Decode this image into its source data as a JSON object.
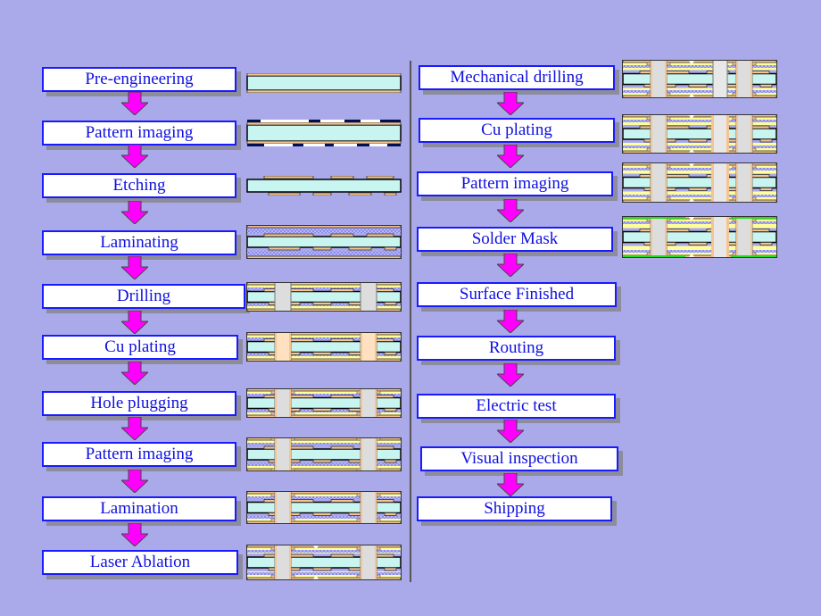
{
  "left_steps": [
    {
      "label": "Pre-engineering"
    },
    {
      "label": "Pattern imaging"
    },
    {
      "label": "Etching"
    },
    {
      "label": "Laminating"
    },
    {
      "label": "Drilling"
    },
    {
      "label": "Cu plating"
    },
    {
      "label": "Hole plugging"
    },
    {
      "label": "Pattern imaging"
    },
    {
      "label": "Lamination"
    },
    {
      "label": "Laser Ablation"
    }
  ],
  "right_steps": [
    {
      "label": "Mechanical drilling"
    },
    {
      "label": "Cu plating"
    },
    {
      "label": "Pattern imaging"
    },
    {
      "label": "Solder Mask"
    },
    {
      "label": "Surface Finished"
    },
    {
      "label": "Routing"
    },
    {
      "label": "Electric test"
    },
    {
      "label": "Visual inspection"
    },
    {
      "label": "Shipping"
    }
  ],
  "colors": {
    "background": "#aaaaea",
    "box_border": "#1a1aff",
    "text": "#1010e0",
    "arrow": "#ff00ff",
    "core": "#c8f5f0",
    "copper": "#f5c490",
    "prepreg": "#8a8af0",
    "resin": "#ffff99",
    "solder_mask": "#22dd22"
  }
}
